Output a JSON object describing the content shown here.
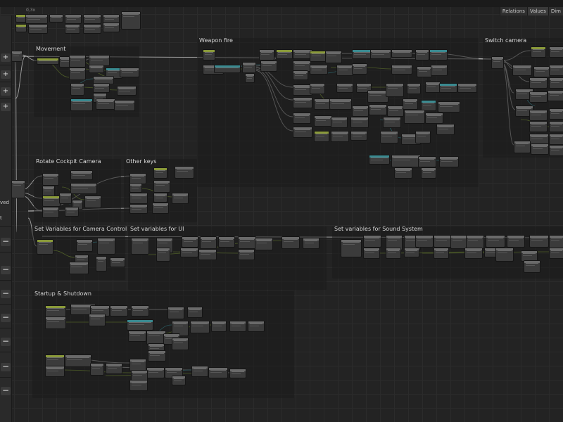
{
  "toolbar": {
    "zoom": "0,3x"
  },
  "right_tabs": [
    "Relations",
    "Values",
    "Dim"
  ],
  "left_panel": {
    "button_plus": "+",
    "button_minus": "−",
    "text_ved": "ved",
    "text_t": "t"
  },
  "groups": [
    {
      "id": "movement",
      "title": "Movement"
    },
    {
      "id": "weapon-fire",
      "title": "Weapon fire"
    },
    {
      "id": "switch-camera",
      "title": "Switch camera"
    },
    {
      "id": "rotate-cockpit-camera",
      "title": "Rotate Cockpit Camera"
    },
    {
      "id": "other-keys",
      "title": "Other keys"
    },
    {
      "id": "set-variables-camera-control",
      "title": "Set Variables for Camera Control"
    },
    {
      "id": "set-variables-ui",
      "title": "Set variables for UI"
    },
    {
      "id": "set-variables-sound-system",
      "title": "Set variables for Sound System"
    },
    {
      "id": "startup-shutdown",
      "title": "Startup & Shutdown"
    }
  ],
  "colors": {
    "wire_white": "#cfcfcf",
    "wire_green": "#9bc23a",
    "wire_teal": "#3fb3c2",
    "node_body": "#3b3b3b",
    "canvas": "#232323"
  }
}
